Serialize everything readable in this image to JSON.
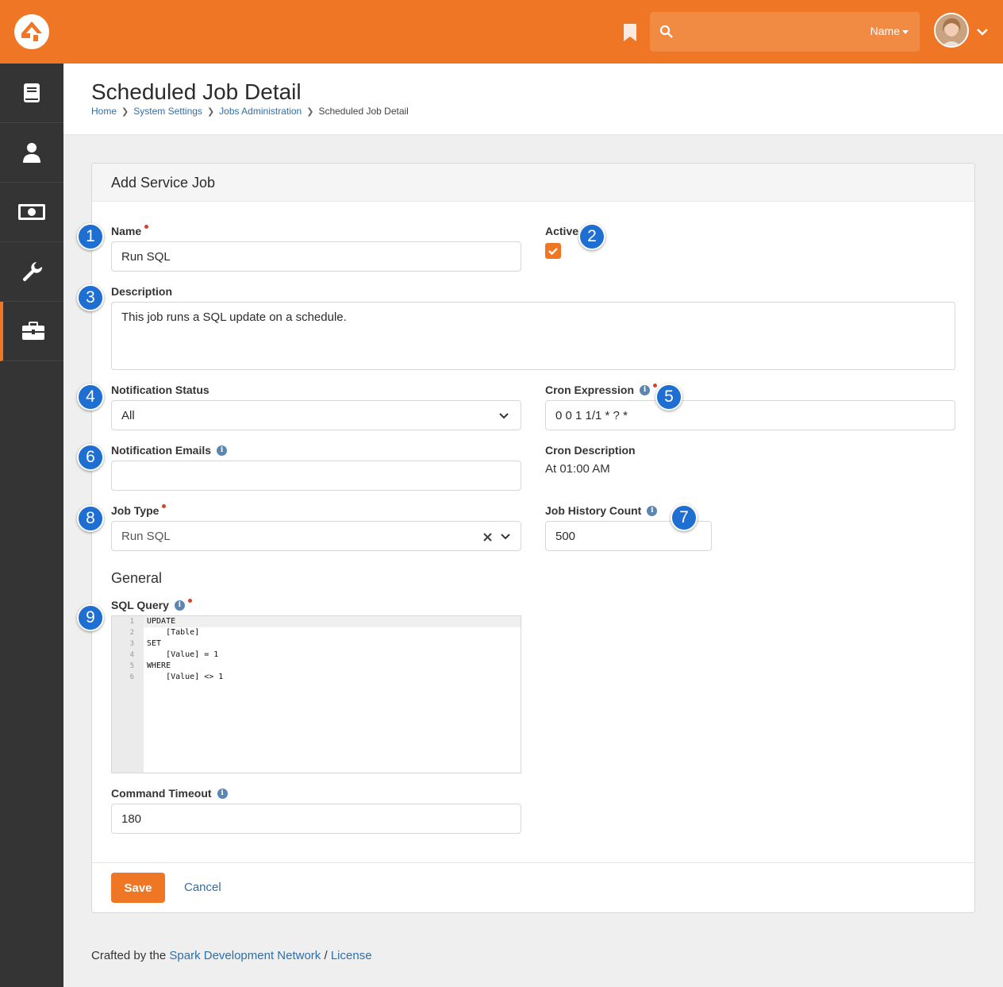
{
  "colors": {
    "accent": "#ee7624",
    "sidebar": "#343434",
    "link": "#2f6fa8",
    "callout": "#1f6ed1"
  },
  "topbar": {
    "search_placeholder": "",
    "search_filter": "Name",
    "icons": [
      "rock-logo-icon",
      "bookmark-icon",
      "search-icon",
      "chevron-down-icon"
    ]
  },
  "sidebar": {
    "items": [
      {
        "icon": "book-icon"
      },
      {
        "icon": "person-icon"
      },
      {
        "icon": "money-icon"
      },
      {
        "icon": "wrench-icon"
      },
      {
        "icon": "briefcase-icon",
        "active": true
      }
    ]
  },
  "header": {
    "title": "Scheduled Job Detail",
    "breadcrumb": [
      "Home",
      "System Settings",
      "Jobs Administration",
      "Scheduled Job Detail"
    ]
  },
  "panel": {
    "title": "Add Service Job",
    "name": {
      "label": "Name",
      "value": "Run SQL"
    },
    "active": {
      "label": "Active",
      "checked": true
    },
    "description": {
      "label": "Description",
      "value": "This job runs a SQL update on a schedule."
    },
    "notification_status": {
      "label": "Notification Status",
      "value": "All"
    },
    "cron_expression": {
      "label": "Cron Expression",
      "value": "0 0 1 1/1 * ? *"
    },
    "notification_emails": {
      "label": "Notification Emails",
      "value": ""
    },
    "cron_description": {
      "label": "Cron Description",
      "value": "At 01:00 AM"
    },
    "job_type": {
      "label": "Job Type",
      "value": "Run SQL"
    },
    "job_history_count": {
      "label": "Job History Count",
      "value": "500"
    },
    "section_general": "General",
    "sql_query": {
      "label": "SQL Query",
      "line_numbers": [
        "1",
        "2",
        "3",
        "4",
        "5",
        "6"
      ],
      "lines": [
        "UPDATE",
        "    [Table]",
        "SET",
        "    [Value] = 1",
        "WHERE",
        "    [Value] <> 1"
      ]
    },
    "command_timeout": {
      "label": "Command Timeout",
      "value": "180"
    },
    "save_label": "Save",
    "cancel_label": "Cancel"
  },
  "callouts": [
    "1",
    "2",
    "3",
    "4",
    "5",
    "6",
    "7",
    "8",
    "9"
  ],
  "footer": {
    "prefix": "Crafted by the ",
    "link1": "Spark Development Network",
    "sep": " / ",
    "link2": "License"
  }
}
